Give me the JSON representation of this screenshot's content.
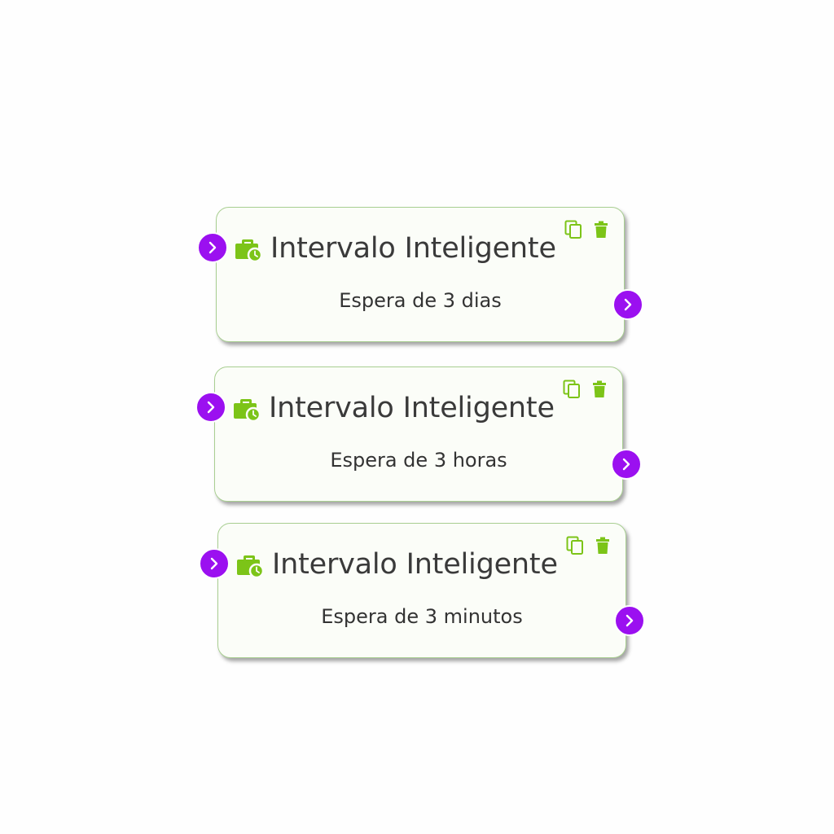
{
  "colors": {
    "accent_green": "#7cc418",
    "port_purple": "#9b10f0",
    "node_border": "#a9cf92",
    "node_bg": "#fbfdf8"
  },
  "icons": {
    "node_icon": "briefcase-clock-icon",
    "duplicate": "copy-icon",
    "delete": "trash-icon",
    "port": "chevron-right-icon"
  },
  "nodes": [
    {
      "title": "Intervalo Inteligente",
      "subtitle": "Espera de 3 dias"
    },
    {
      "title": "Intervalo Inteligente",
      "subtitle": "Espera de 3 horas"
    },
    {
      "title": "Intervalo Inteligente",
      "subtitle": "Espera de 3 minutos"
    }
  ]
}
